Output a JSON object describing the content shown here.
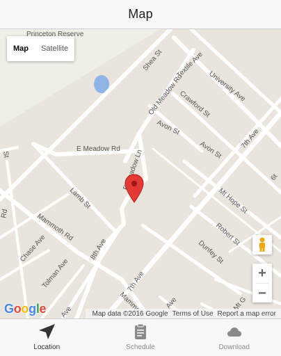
{
  "header": {
    "title": "Map"
  },
  "map": {
    "type_control": {
      "map_label": "Map",
      "satellite_label": "Satellite",
      "selected": "Map"
    },
    "labels": {
      "princeton_reserve": "Princeton Reserve",
      "textile_ave": "Textile Ave",
      "shea_st": "Shea St",
      "old_meadow_rd": "Old Meadow Rd",
      "university_ave": "University Ave",
      "crawford_st": "Crawford St",
      "avon_st_1": "Avon St",
      "avon_st_2": "Avon St",
      "seventh_ave_1": "7th Ave",
      "seventh_ave_2": "7th Ave",
      "e_meadow_rd": "E Meadow Rd",
      "e_meadow_ln": "E Meadow Ln",
      "lamb_st": "Lamb St",
      "mt_hope_st": "Mt Hope St",
      "mammoth_rd_1": "Mammoth Rd",
      "mammoth_rd_2": "Mammoth",
      "chase_ave": "Chase Ave",
      "eighth_ave": "8th Ave",
      "robert_st": "Robert St",
      "dunfey_st": "Dunfey St",
      "tolman_ave": "Tolman Ave",
      "rd_left": "Rd",
      "mt_g": "Mt G",
      "ave_bottom_1": "Ave",
      "ave_bottom_2": "Ave",
      "st_left": "St",
      "sixth_right": "6t"
    },
    "logo_text": "Google",
    "attribution": {
      "map_data": "Map data ©2016 Google",
      "terms": "Terms of Use",
      "report": "Report a map error"
    },
    "zoom": {
      "in": "+",
      "out": "−"
    },
    "colors": {
      "land": "#e9e5dc",
      "road": "#ffffff",
      "water": "#8fb4e8",
      "marker": "#e53935"
    }
  },
  "tabbar": {
    "items": [
      {
        "label": "Location",
        "icon": "navigation-arrow-icon",
        "active": true
      },
      {
        "label": "Schedule",
        "icon": "clipboard-icon",
        "active": false
      },
      {
        "label": "Download",
        "icon": "cloud-icon",
        "active": false
      }
    ]
  }
}
